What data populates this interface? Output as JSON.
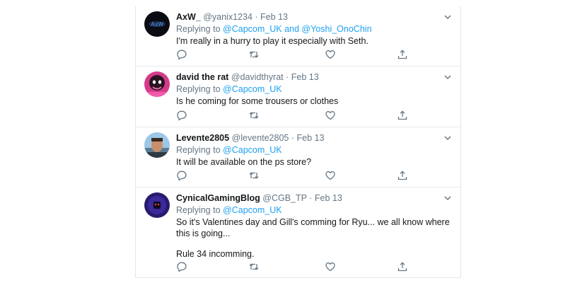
{
  "tweets": [
    {
      "name": "AxW_",
      "handle": "@yanix1234",
      "sep": "·",
      "time": "Feb 13",
      "replying_prefix": "Replying to",
      "mention1": "@Capcom_UK",
      "conj": "and",
      "mention2": "@Yoshi_OnoChin",
      "text1": "I'm really in a hurry to play it especially with Seth.",
      "text2": "",
      "avatar_color": "#0b0b14"
    },
    {
      "name": "david the rat",
      "handle": "@davidthyrat",
      "sep": "·",
      "time": "Feb 13",
      "replying_prefix": "Replying to",
      "mention1": "@Capcom_UK",
      "text1": "Is he coming for some trousers or clothes",
      "text2": "",
      "avatar_color": "#d43b8a"
    },
    {
      "name": "Levente2805",
      "handle": "@levente2805",
      "sep": "·",
      "time": "Feb 13",
      "replying_prefix": "Replying to",
      "mention1": "@Capcom_UK",
      "text1": "It will be available on the ps store?",
      "text2": "",
      "avatar_color": "#7fb3d6"
    },
    {
      "name": "CynicalGamingBlog",
      "handle": "@CGB_TP",
      "sep": "·",
      "time": "Feb 13",
      "replying_prefix": "Replying to",
      "mention1": "@Capcom_UK",
      "text1": "So it's Valentines day and Gill's comming for Ryu... we all know where this is going...",
      "text2": "Rule 34 incomming.",
      "avatar_color": "#2a1a6e"
    }
  ],
  "icons": {
    "more": "chevron-down-icon",
    "reply": "reply-icon",
    "retweet": "retweet-icon",
    "like": "heart-icon",
    "share": "share-icon"
  },
  "colors": {
    "accent": "#1da1f2",
    "muted": "#657786",
    "text": "#14171a",
    "border": "#e6ecf0"
  }
}
